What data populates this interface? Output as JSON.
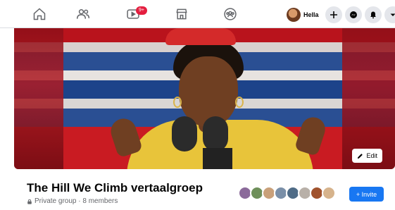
{
  "nav": {
    "icons": [
      "home-icon",
      "friends-icon",
      "watch-icon",
      "marketplace-icon",
      "groups-icon"
    ],
    "watch_badge": "9+",
    "profile_name": "Hella",
    "actions": [
      "plus-icon",
      "messenger-icon",
      "bell-icon",
      "caret-down-icon"
    ]
  },
  "cover": {
    "edit_label": "Edit"
  },
  "group": {
    "title": "The Hill We Climb vertaalgroep",
    "meta": "Private group · 8 members",
    "member_count": 8,
    "invite_label": "+ Invite"
  },
  "colors": {
    "accent": "#1877f2",
    "badge": "#e41e3f",
    "background": "#f0f2f5"
  }
}
